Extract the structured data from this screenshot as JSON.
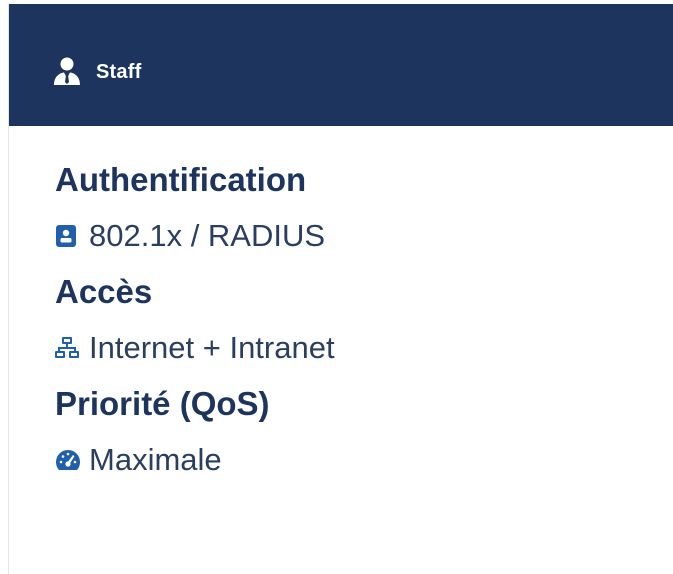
{
  "header": {
    "title": "Staff",
    "icon": "user-tie-icon",
    "background_color": "#1d355e"
  },
  "sections": [
    {
      "label": "Authentification",
      "value": "802.1x / RADIUS",
      "icon": "address-card-icon"
    },
    {
      "label": "Accès",
      "value": "Internet + Intranet",
      "icon": "network-icon"
    },
    {
      "label": "Priorité (QoS)",
      "value": "Maximale",
      "icon": "speedometer-icon"
    }
  ],
  "colors": {
    "accent": "#1d355e",
    "icon_blue": "#1f5fae"
  }
}
